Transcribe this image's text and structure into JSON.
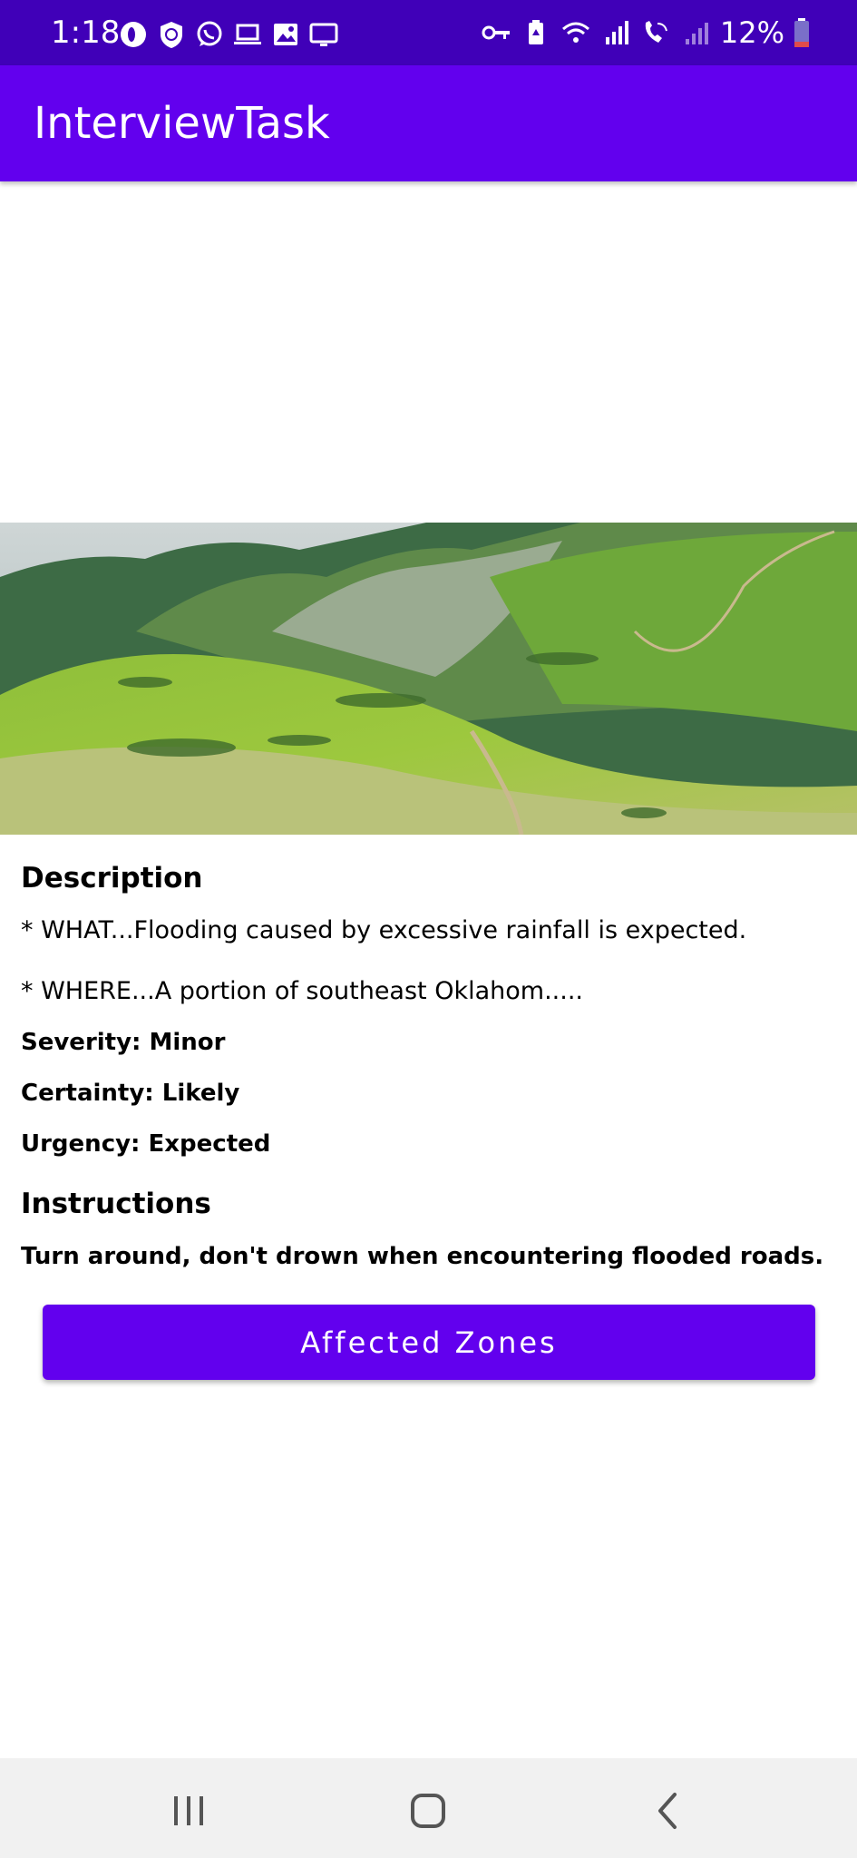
{
  "status_bar": {
    "time": "1:18",
    "battery": "12%",
    "icons_left": [
      "opera-icon",
      "vpn-shield-icon",
      "whatsapp-icon",
      "laptop-icon",
      "image-icon",
      "cast-screen-icon"
    ],
    "icons_right": [
      "key-icon",
      "battery-saver-icon",
      "wifi-icon",
      "signal-icon",
      "wifi-call-icon",
      "signal-2-icon",
      "battery-icon"
    ]
  },
  "app_bar": {
    "title": "InterviewTask"
  },
  "details": {
    "description_heading": "Description",
    "what": "* WHAT...Flooding caused by excessive rainfall is expected.",
    "where": "* WHERE...A portion of southeast Oklahom.....",
    "severity": "Severity: Minor",
    "certainty": "Certainty: Likely",
    "urgency": "Urgency: Expected",
    "instructions_heading": "Instructions",
    "instructions": "Turn around, don't drown when encountering flooded roads."
  },
  "button": {
    "label": "Affected Zones"
  },
  "nav": {
    "recents": "recents-icon",
    "home": "home-icon",
    "back": "back-icon"
  },
  "colors": {
    "status_bar": "#4000b8",
    "app_bar": "#6200ee",
    "button": "#6200ee"
  }
}
